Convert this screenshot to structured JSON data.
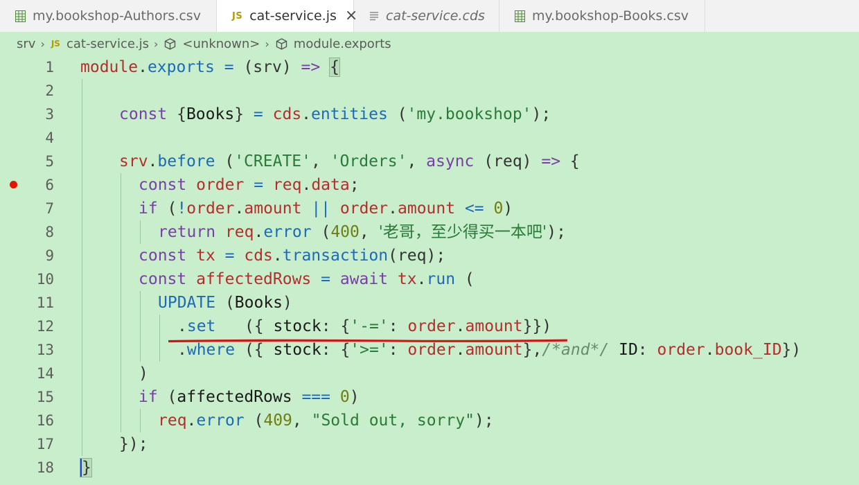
{
  "tabs": [
    {
      "name": "my.bookshop-Authors.csv",
      "icon": "csv-file-icon",
      "active": false,
      "italic": false
    },
    {
      "name": "cat-service.js",
      "icon": "js-file-icon",
      "active": true,
      "italic": false,
      "close": "×"
    },
    {
      "name": "cat-service.cds",
      "icon": "cds-file-icon",
      "active": false,
      "italic": true
    },
    {
      "name": "my.bookshop-Books.csv",
      "icon": "csv-file-icon",
      "active": false,
      "italic": false
    }
  ],
  "js_badge": "JS",
  "breadcrumb": [
    "srv",
    "cat-service.js",
    "<unknown>",
    "module.exports"
  ],
  "line_numbers": [
    "1",
    "2",
    "3",
    "4",
    "5",
    "6",
    "7",
    "8",
    "9",
    "10",
    "11",
    "12",
    "13",
    "14",
    "15",
    "16",
    "17",
    "18"
  ],
  "code": {
    "l1": [
      "module",
      ".",
      "exports",
      " = ",
      "(",
      "srv",
      ") ",
      "=>",
      " ",
      "{"
    ],
    "l3": [
      "const",
      " {",
      "Books",
      "} ",
      "=",
      " ",
      "cds",
      ".",
      "entities",
      " (",
      "'my.bookshop'",
      ");"
    ],
    "l5": [
      "srv",
      ".",
      "before",
      " (",
      "'CREATE'",
      ", ",
      "'Orders'",
      ", ",
      "async",
      " (",
      "req",
      ") ",
      "=>",
      " {"
    ],
    "l6": [
      "const",
      " ",
      "order",
      " = ",
      "req",
      ".",
      "data",
      ";"
    ],
    "l7": [
      "if",
      " (",
      "!",
      "order",
      ".",
      "amount",
      " ",
      "||",
      " ",
      "order",
      ".",
      "amount",
      " ",
      "<=",
      " ",
      "0",
      ")"
    ],
    "l8": [
      "return",
      " ",
      "req",
      ".",
      "error",
      " (",
      "400",
      ", ",
      "'老哥，至少得买一本吧'",
      ");"
    ],
    "l9": [
      "const",
      " ",
      "tx",
      " = ",
      "cds",
      ".",
      "transaction",
      "(",
      "req",
      ");"
    ],
    "l10": [
      "const",
      " ",
      "affectedRows",
      " = ",
      "await",
      " ",
      "tx",
      ".",
      "run",
      " ("
    ],
    "l11": [
      "UPDATE",
      " (",
      "Books",
      ")"
    ],
    "l12": [
      ".",
      "set",
      "   ({ ",
      "stock",
      ": {",
      "'-='",
      ": ",
      "order",
      ".",
      "amount",
      "}})"
    ],
    "l13": [
      ".",
      "where",
      " ({ ",
      "stock",
      ": {",
      "'>='",
      ": ",
      "order",
      ".",
      "amount",
      "},",
      "/*and*/",
      " ",
      "ID",
      ": ",
      "order",
      ".",
      "book_ID",
      "})"
    ],
    "l14": [
      ")"
    ],
    "l15": [
      "if",
      " (",
      "affectedRows",
      " ",
      "===",
      " ",
      "0",
      ")"
    ],
    "l16": [
      "req",
      ".",
      "error",
      " (",
      "409",
      ", ",
      "\"Sold out, sorry\"",
      ");"
    ],
    "l17": [
      "});"
    ],
    "l18": [
      "}"
    ]
  },
  "colors": {
    "editor_bg": "#c8eecb",
    "keyword": "#7a3ea8",
    "function": "#1c6ab8",
    "variable": "#b52d2d",
    "string": "#2a7a3a",
    "number": "#6f7d14",
    "breakpoint": "#e51400",
    "annotation_underline": "#d41414"
  }
}
